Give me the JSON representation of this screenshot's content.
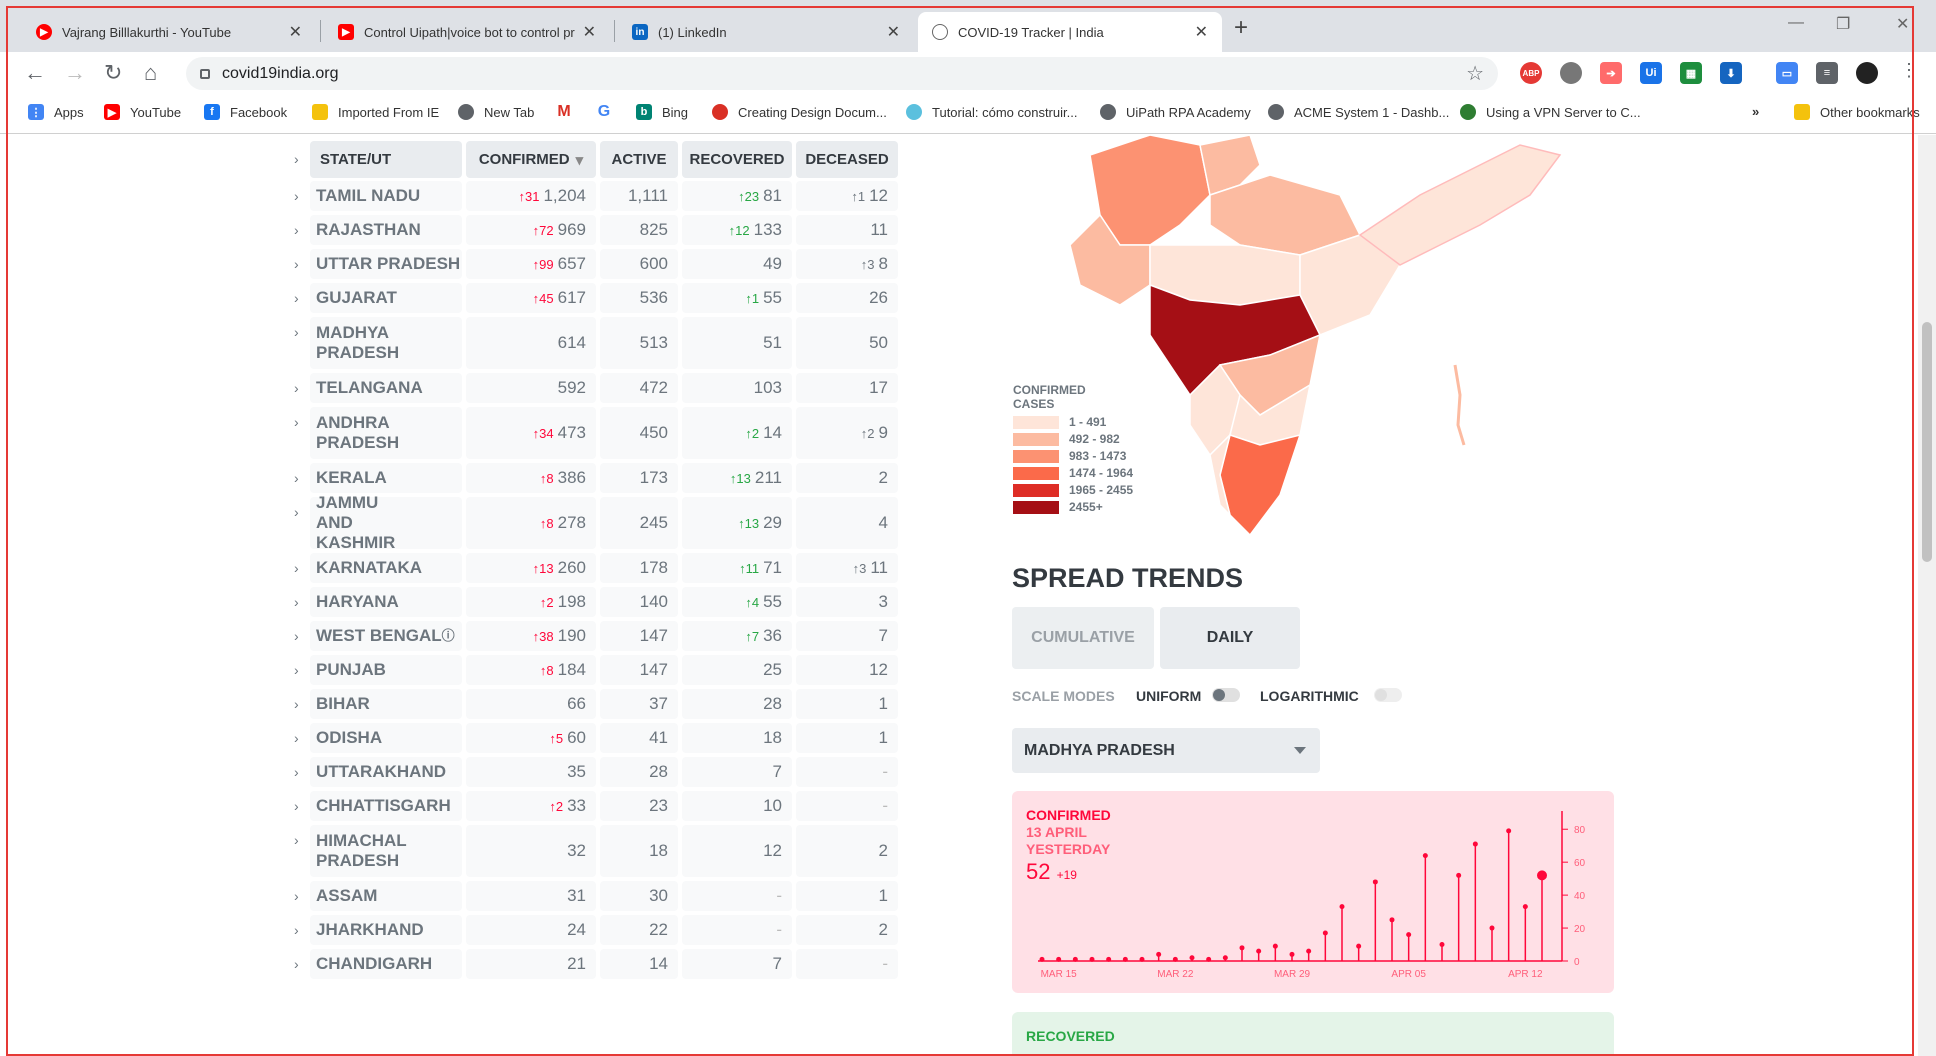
{
  "browser": {
    "tabs": [
      {
        "title": "Vajrang Billlakurthi - YouTube",
        "icon": "youtube-icon",
        "active": false
      },
      {
        "title": "Control Uipath|voice bot to control pre",
        "icon": "youtube-icon",
        "active": false
      },
      {
        "title": "(1) LinkedIn",
        "icon": "linkedin-icon",
        "active": false
      },
      {
        "title": "COVID-19 Tracker | India",
        "icon": "covid-icon",
        "active": true
      }
    ],
    "url": "covid19india.org",
    "bookmarks": [
      {
        "label": "Apps",
        "icon": "apps-icon",
        "color": "#4285f4"
      },
      {
        "label": "YouTube",
        "icon": "youtube-icon",
        "color": "#ff0000"
      },
      {
        "label": "Facebook",
        "icon": "facebook-icon",
        "color": "#1877f2"
      },
      {
        "label": "Imported From IE",
        "icon": "folder-icon",
        "color": "#f4c20d"
      },
      {
        "label": "New Tab",
        "icon": "globe-icon",
        "color": "#5f6368"
      },
      {
        "label": "",
        "icon": "gmail-icon",
        "color": "#d93025"
      },
      {
        "label": "",
        "icon": "google-icon",
        "color": "#4285f4"
      },
      {
        "label": "Bing",
        "icon": "bing-icon",
        "color": "#008373"
      },
      {
        "label": "Creating Design Docum...",
        "icon": "page-icon",
        "color": "#d93025"
      },
      {
        "label": "Tutorial: cómo construir...",
        "icon": "drop-icon",
        "color": "#5bc0de"
      },
      {
        "label": "UiPath RPA Academy",
        "icon": "globe-icon",
        "color": "#5f6368"
      },
      {
        "label": "ACME System 1 - Dashb...",
        "icon": "globe-icon",
        "color": "#5f6368"
      },
      {
        "label": "Using a VPN Server to C...",
        "icon": "vpn-icon",
        "color": "#2e7d32"
      }
    ],
    "more_bookmarks": "»",
    "other_bookmarks": "Other bookmarks"
  },
  "table": {
    "headers": {
      "state": "STATE/UT",
      "confirmed": "CONFIRMED",
      "active": "ACTIVE",
      "recovered": "RECOVERED",
      "deceased": "DECEASED"
    },
    "rows": [
      {
        "state": "TAMIL NADU",
        "dc": "↑31",
        "confirmed": "1,204",
        "active": "1,111",
        "dr": "↑23",
        "recovered": "81",
        "dd": "↑1",
        "deceased": "12"
      },
      {
        "state": "RAJASTHAN",
        "dc": "↑72",
        "confirmed": "969",
        "active": "825",
        "dr": "↑12",
        "recovered": "133",
        "dd": "",
        "deceased": "11"
      },
      {
        "state": "UTTAR PRADESH",
        "dc": "↑99",
        "confirmed": "657",
        "active": "600",
        "dr": "",
        "recovered": "49",
        "dd": "↑3",
        "deceased": "8"
      },
      {
        "state": "GUJARAT",
        "dc": "↑45",
        "confirmed": "617",
        "active": "536",
        "dr": "↑1",
        "recovered": "55",
        "dd": "",
        "deceased": "26"
      },
      {
        "state": "MADHYA PRADESH",
        "dc": "",
        "confirmed": "614",
        "active": "513",
        "dr": "",
        "recovered": "51",
        "dd": "",
        "deceased": "50",
        "two": true
      },
      {
        "state": "TELANGANA",
        "dc": "",
        "confirmed": "592",
        "active": "472",
        "dr": "",
        "recovered": "103",
        "dd": "",
        "deceased": "17"
      },
      {
        "state": "ANDHRA PRADESH",
        "dc": "↑34",
        "confirmed": "473",
        "active": "450",
        "dr": "↑2",
        "recovered": "14",
        "dd": "↑2",
        "deceased": "9",
        "two": true
      },
      {
        "state": "KERALA",
        "dc": "↑8",
        "confirmed": "386",
        "active": "173",
        "dr": "↑13",
        "recovered": "211",
        "dd": "",
        "deceased": "2"
      },
      {
        "state": "JAMMU AND KASHMIR",
        "dc": "↑8",
        "confirmed": "278",
        "active": "245",
        "dr": "↑13",
        "recovered": "29",
        "dd": "",
        "deceased": "4",
        "two": true
      },
      {
        "state": "KARNATAKA",
        "dc": "↑13",
        "confirmed": "260",
        "active": "178",
        "dr": "↑11",
        "recovered": "71",
        "dd": "↑3",
        "deceased": "11"
      },
      {
        "state": "HARYANA",
        "dc": "↑2",
        "confirmed": "198",
        "active": "140",
        "dr": "↑4",
        "recovered": "55",
        "dd": "",
        "deceased": "3"
      },
      {
        "state": "WEST BENGAL",
        "dc": "↑38",
        "confirmed": "190",
        "active": "147",
        "dr": "↑7",
        "recovered": "36",
        "dd": "",
        "deceased": "7",
        "info": true
      },
      {
        "state": "PUNJAB",
        "dc": "↑8",
        "confirmed": "184",
        "active": "147",
        "dr": "",
        "recovered": "25",
        "dd": "",
        "deceased": "12"
      },
      {
        "state": "BIHAR",
        "dc": "",
        "confirmed": "66",
        "active": "37",
        "dr": "",
        "recovered": "28",
        "dd": "",
        "deceased": "1"
      },
      {
        "state": "ODISHA",
        "dc": "↑5",
        "confirmed": "60",
        "active": "41",
        "dr": "",
        "recovered": "18",
        "dd": "",
        "deceased": "1"
      },
      {
        "state": "UTTARAKHAND",
        "dc": "",
        "confirmed": "35",
        "active": "28",
        "dr": "",
        "recovered": "7",
        "dd": "",
        "deceased": "-"
      },
      {
        "state": "CHHATTISGARH",
        "dc": "↑2",
        "confirmed": "33",
        "active": "23",
        "dr": "",
        "recovered": "10",
        "dd": "",
        "deceased": "-"
      },
      {
        "state": "HIMACHAL PRADESH",
        "dc": "",
        "confirmed": "32",
        "active": "18",
        "dr": "",
        "recovered": "12",
        "dd": "",
        "deceased": "2",
        "two": true
      },
      {
        "state": "ASSAM",
        "dc": "",
        "confirmed": "31",
        "active": "30",
        "dr": "",
        "recovered": "-",
        "dd": "",
        "deceased": "1"
      },
      {
        "state": "JHARKHAND",
        "dc": "",
        "confirmed": "24",
        "active": "22",
        "dr": "",
        "recovered": "-",
        "dd": "",
        "deceased": "2"
      },
      {
        "state": "CHANDIGARH",
        "dc": "",
        "confirmed": "21",
        "active": "14",
        "dr": "",
        "recovered": "7",
        "dd": "",
        "deceased": "-"
      }
    ]
  },
  "legend": {
    "title_line1": "CONFIRMED",
    "title_line2": "CASES",
    "items": [
      {
        "label": "1 - 491",
        "color": "#fee5d9"
      },
      {
        "label": "492 - 982",
        "color": "#fcbba1"
      },
      {
        "label": "983 - 1473",
        "color": "#fc9272"
      },
      {
        "label": "1474 - 1964",
        "color": "#fb6a4a"
      },
      {
        "label": "1965 - 2455",
        "color": "#de2d26"
      },
      {
        "label": "2455+",
        "color": "#a50f15"
      }
    ]
  },
  "trends": {
    "title": "SPREAD TRENDS",
    "mode_cumulative": "CUMULATIVE",
    "mode_daily": "DAILY",
    "scale_label": "SCALE MODES",
    "uniform": "UNIFORM",
    "logarithmic": "LOGARITHMIC",
    "selected_state": "MADHYA PRADESH",
    "confirmed_card": {
      "title": "CONFIRMED",
      "date": "13 APRIL",
      "when": "YESTERDAY",
      "value": "52",
      "delta": "+19"
    },
    "recovered_card": {
      "title": "RECOVERED"
    }
  },
  "chart_data": {
    "type": "bar",
    "x_ticks": [
      "MAR 15",
      "MAR 22",
      "MAR 29",
      "APR 05",
      "APR 12"
    ],
    "y_ticks": [
      "80",
      "60",
      "40",
      "20",
      "0"
    ],
    "ylim": [
      0,
      85
    ],
    "values": [
      1,
      1,
      1,
      1,
      1,
      1,
      1,
      4,
      1,
      2,
      1,
      2,
      8,
      6,
      9,
      4,
      6,
      17,
      33,
      9,
      48,
      25,
      16,
      64,
      10,
      52,
      71,
      20,
      79,
      33,
      52
    ]
  },
  "colors": {
    "confirmed": "#ff073a",
    "recovered": "#28a745",
    "map_dark": "#a50f15"
  }
}
